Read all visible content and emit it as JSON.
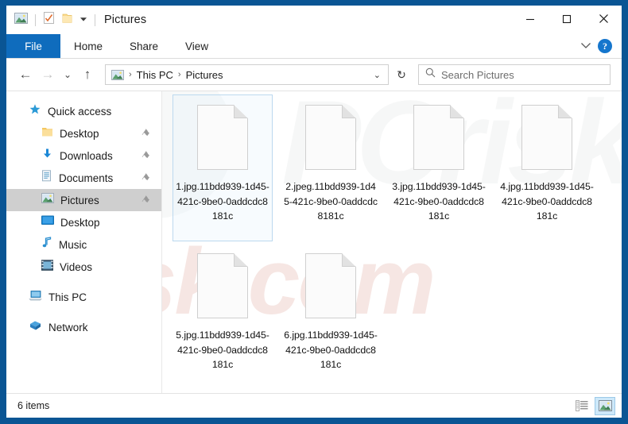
{
  "window": {
    "title": "Pictures",
    "quick_access_icons": [
      "pictures-folder-icon",
      "properties-icon",
      "new-folder-icon",
      "customize-dropdown-icon"
    ],
    "minimize_label": "─",
    "maximize_label": "□",
    "close_label": "✕"
  },
  "ribbon": {
    "tabs": [
      {
        "label": "File",
        "active": true
      },
      {
        "label": "Home",
        "active": false
      },
      {
        "label": "Share",
        "active": false
      },
      {
        "label": "View",
        "active": false
      }
    ],
    "expand_chevron": "⌄",
    "help_label": "?"
  },
  "navigation": {
    "back_glyph": "←",
    "forward_glyph": "→",
    "recent_glyph": "⌄",
    "up_glyph": "↑",
    "refresh_glyph": "↻",
    "address_chevron": "⌄",
    "breadcrumb": [
      "This PC",
      "Pictures"
    ],
    "breadcrumb_separator": "›"
  },
  "search": {
    "placeholder": "Search Pictures",
    "icon": "search-icon"
  },
  "sidebar": {
    "items": [
      {
        "label": "Quick access",
        "icon": "star-icon",
        "level": "root",
        "pinned": false,
        "selected": false
      },
      {
        "label": "Desktop",
        "icon": "folder-icon",
        "level": "child",
        "pinned": true,
        "selected": false
      },
      {
        "label": "Downloads",
        "icon": "download-icon",
        "level": "child",
        "pinned": true,
        "selected": false
      },
      {
        "label": "Documents",
        "icon": "documents-icon",
        "level": "child",
        "pinned": true,
        "selected": false
      },
      {
        "label": "Pictures",
        "icon": "pictures-icon",
        "level": "child",
        "pinned": true,
        "selected": true
      },
      {
        "label": "Desktop",
        "icon": "desktop-icon",
        "level": "child",
        "pinned": false,
        "selected": false
      },
      {
        "label": "Music",
        "icon": "music-note-icon",
        "level": "child",
        "pinned": false,
        "selected": false
      },
      {
        "label": "Videos",
        "icon": "videos-icon",
        "level": "child",
        "pinned": false,
        "selected": false
      },
      {
        "label": "This PC",
        "icon": "computer-icon",
        "level": "root",
        "pinned": false,
        "selected": false
      },
      {
        "label": "Network",
        "icon": "network-icon",
        "level": "root",
        "pinned": false,
        "selected": false
      }
    ],
    "pin_glyph": "⚑"
  },
  "files": [
    {
      "name": "1.jpg.11bdd939-1d45-421c-9be0-0addcdc8181c",
      "icon": "generic-file-icon",
      "selected": true
    },
    {
      "name": "2.jpeg.11bdd939-1d45-421c-9be0-0addcdc8181c",
      "icon": "generic-file-icon",
      "selected": false
    },
    {
      "name": "3.jpg.11bdd939-1d45-421c-9be0-0addcdc8181c",
      "icon": "generic-file-icon",
      "selected": false
    },
    {
      "name": "4.jpg.11bdd939-1d45-421c-9be0-0addcdc8181c",
      "icon": "generic-file-icon",
      "selected": false
    },
    {
      "name": "5.jpg.11bdd939-1d45-421c-9be0-0addcdc8181c",
      "icon": "generic-file-icon",
      "selected": false
    },
    {
      "name": "6.jpg.11bdd939-1d45-421c-9be0-0addcdc8181c",
      "icon": "generic-file-icon",
      "selected": false
    }
  ],
  "statusbar": {
    "item_count": "6 items",
    "details_view": "details-view-icon",
    "large_icons_view": "large-icons-view-icon"
  },
  "watermark": {
    "top_text": "PCrisk",
    "bottom_text": "risk.com"
  },
  "colors": {
    "window_border": "#0a5594",
    "file_tab": "#0f6cbd",
    "selection": "#cfcfcf",
    "tile_selection_border": "#bcd9ef",
    "help_button": "#1576cd",
    "view_active": "#cde8f9"
  }
}
